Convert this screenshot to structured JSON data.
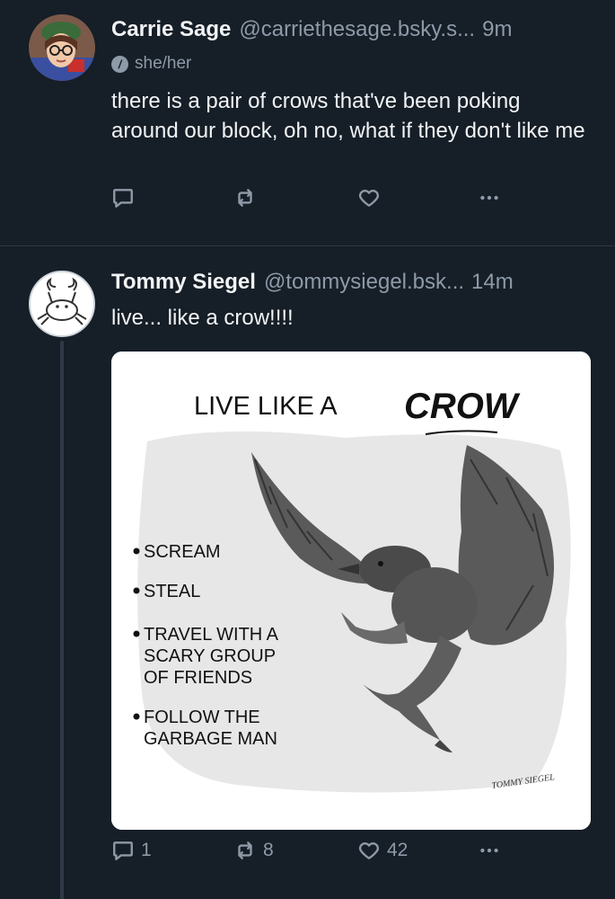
{
  "posts": [
    {
      "author_name": "Carrie Sage",
      "handle": "@carriethesage.bsky.s...",
      "time": "9m",
      "pronouns": "she/her",
      "text": "there is a pair of crows that've been poking around our block, oh no, what if they don't like me",
      "reply_count": "",
      "repost_count": "",
      "like_count": ""
    },
    {
      "author_name": "Tommy Siegel",
      "handle": "@tommysiegel.bsk...",
      "time": "14m",
      "text": "live... like a crow!!!!",
      "reply_count": "1",
      "repost_count": "8",
      "like_count": "42",
      "image": {
        "title_prefix": "LIVE LIKE A",
        "title_emphasis": "CROW",
        "items": [
          "SCREAM",
          "STEAL",
          "TRAVEL WITH A",
          "SCARY GROUP",
          "OF FRIENDS",
          "FOLLOW THE",
          "GARBAGE MAN"
        ],
        "signature": "TOMMY SIEGEL"
      }
    }
  ],
  "icons": {
    "reply": "speech-bubble-icon",
    "repost": "repost-arrows-icon",
    "like": "heart-icon",
    "more": "ellipsis-icon"
  }
}
